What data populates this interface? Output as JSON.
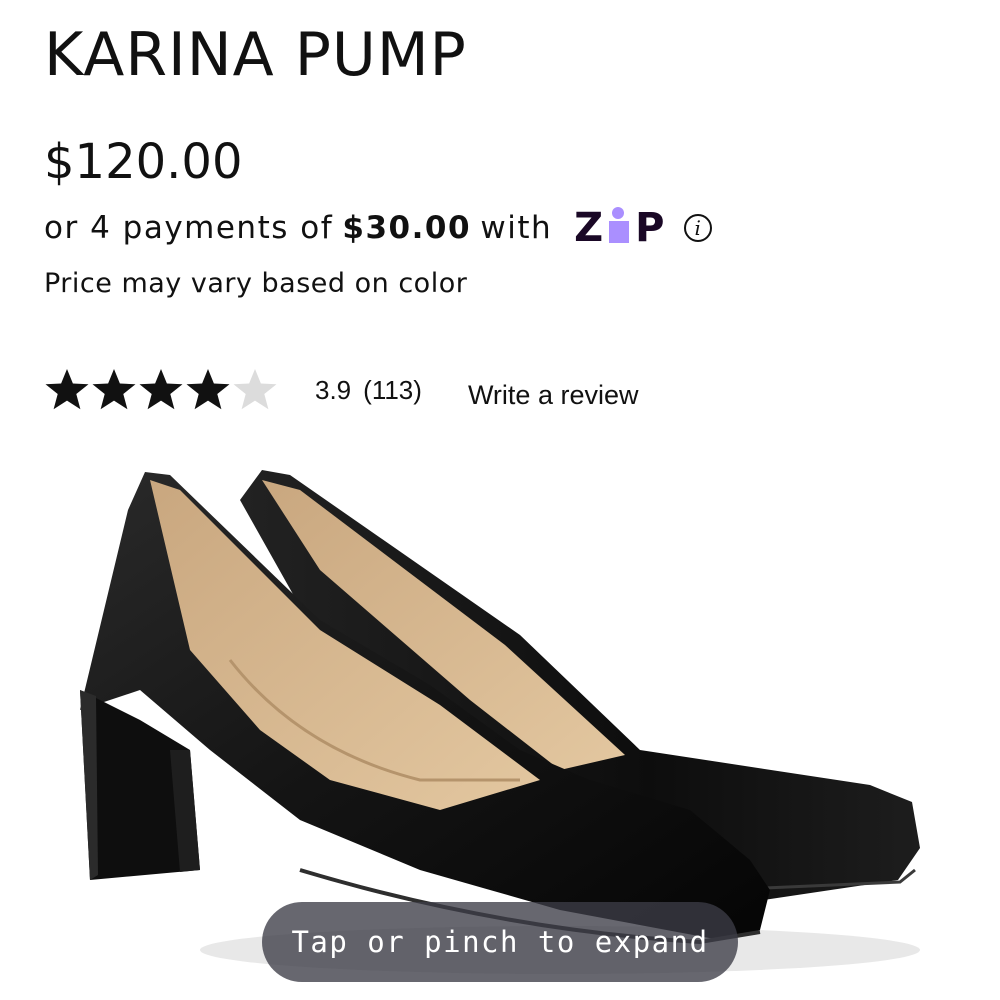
{
  "product": {
    "title": "KARINA PUMP",
    "price": "$120.00",
    "installment_prefix": "or 4 payments of",
    "installment_amount": "$30.00",
    "installment_with": "with",
    "zip_logo": {
      "z": "Z",
      "p": "P"
    },
    "info_icon": "i",
    "price_note": "Price may vary based on color"
  },
  "rating": {
    "value": "3.9",
    "stars_filled": 4,
    "stars_total": 5,
    "count": "(113)",
    "write_review": "Write a review"
  },
  "image": {
    "alt": "Pair of black leather block-heel pumps",
    "expand_hint": "Tap or pinch to expand"
  },
  "colors": {
    "star_filled": "#111111",
    "star_empty": "#dcdcdc",
    "zip_purple": "#aa8fff",
    "zip_dark": "#1a0826",
    "pill_bg": "#3c3c46"
  }
}
